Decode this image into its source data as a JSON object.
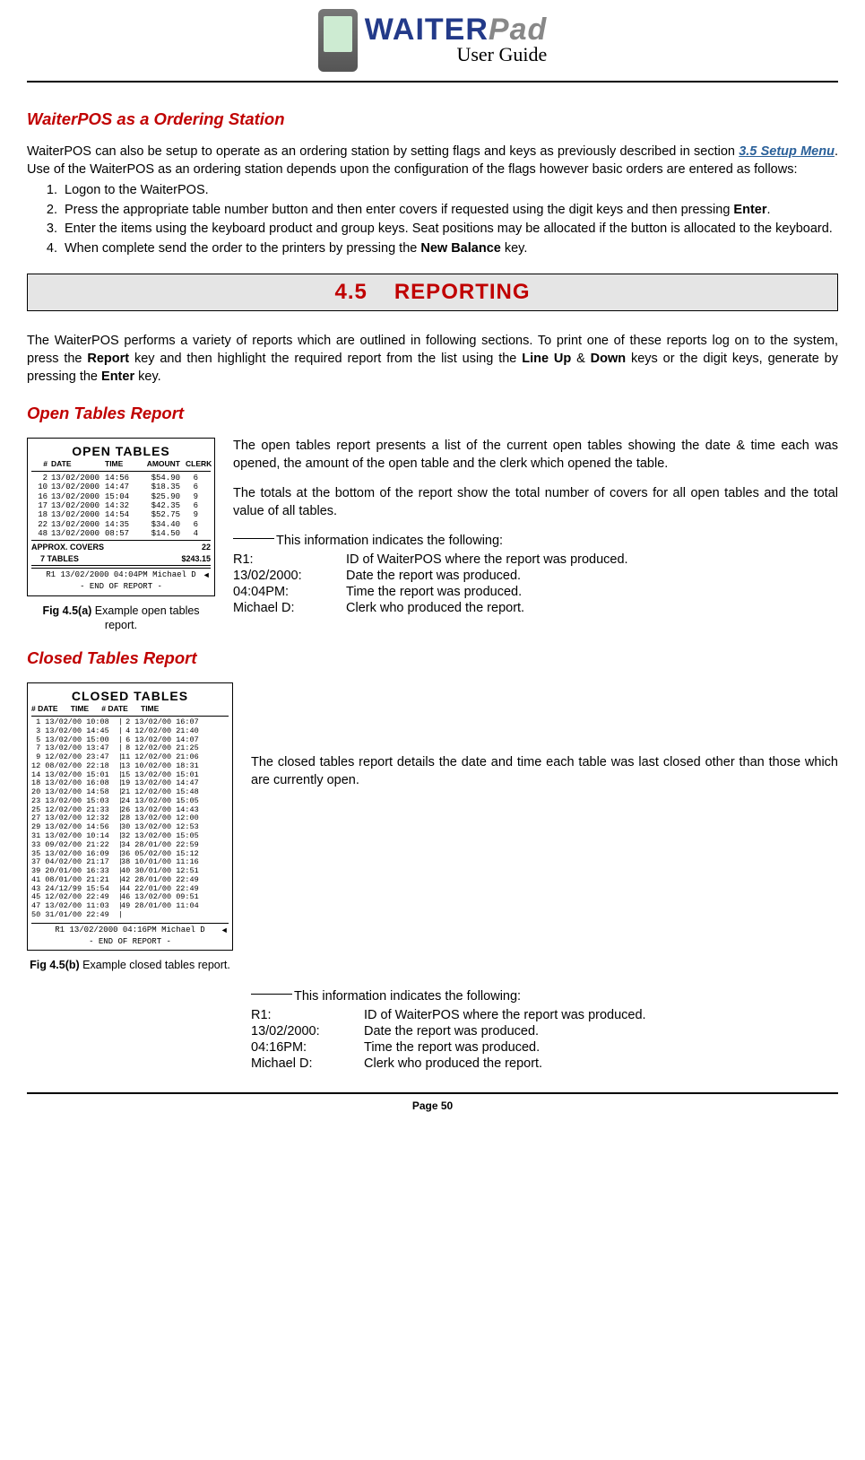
{
  "header": {
    "brand_main": "WAITER",
    "brand_sub": "Pad",
    "guide": "User Guide"
  },
  "s1": {
    "title": "WaiterPOS as a Ordering Station",
    "intro_a": "WaiterPOS can also be setup to operate as an ordering station by setting flags and keys as previously described in section ",
    "link": "3.5 Setup Menu",
    "intro_b": ". Use of the WaiterPOS as an ordering station depends upon the configuration of the flags however basic orders are entered as follows:",
    "steps": [
      "Logon to the WaiterPOS.",
      "Press the appropriate table number button and then enter covers if requested using the digit keys and then pressing <b>Enter</b>.",
      "Enter the items using the keyboard product and group keys. Seat positions may be allocated if the button is allocated to the keyboard.",
      "When complete send the order to the printers by pressing the <b>New Balance</b> key."
    ]
  },
  "chapter": {
    "num": "4.5",
    "title": "REPORTING"
  },
  "reporting_intro": "The WaiterPOS performs a variety of reports which are outlined in following sections. To print one of these reports log on to the system, press the <b>Report</b> key and then highlight the required report from the list using the <b>Line Up</b> & <b>Down</b> keys or the digit keys, generate by pressing the <b>Enter</b> key.",
  "open": {
    "title": "Open Tables Report",
    "fig_title": "OPEN  TABLES",
    "headers": [
      "#",
      "DATE",
      "TIME",
      "AMOUNT",
      "CLERK"
    ],
    "rows": [
      [
        "2",
        "13/02/2000",
        "14:56",
        "$54.90",
        "6"
      ],
      [
        "10",
        "13/02/2000",
        "14:47",
        "$18.35",
        "6"
      ],
      [
        "16",
        "13/02/2000",
        "15:04",
        "$25.90",
        "9"
      ],
      [
        "17",
        "13/02/2000",
        "14:32",
        "$42.35",
        "6"
      ],
      [
        "18",
        "13/02/2000",
        "14:54",
        "$52.75",
        "9"
      ],
      [
        "22",
        "13/02/2000",
        "14:35",
        "$34.40",
        "6"
      ],
      [
        "48",
        "13/02/2000",
        "08:57",
        "$14.50",
        "4"
      ]
    ],
    "totals": {
      "covers_label": "APPROX. COVERS",
      "covers": "22",
      "tables_label": "7 TABLES",
      "tables_amt": "$243.15"
    },
    "footline": "R1 13/02/2000 04:04PM Michael D",
    "endline": "- END OF REPORT -",
    "caption_label": "Fig 4.5(a)",
    "caption_text": " Example open tables report.",
    "para1": "The open tables report presents a list of the current open tables showing the date & time each was opened, the amount of the open table and the clerk which opened the table.",
    "para2": "The totals at the bottom of the report show the total number of covers for all open tables and the total value of all tables.",
    "info_lead": "This information indicates the following:",
    "info": [
      [
        "R1:",
        "ID of WaiterPOS where the report was produced."
      ],
      [
        "13/02/2000:",
        "Date the report was produced."
      ],
      [
        "04:04PM:",
        "Time the report was produced."
      ],
      [
        "Michael D:",
        "Clerk who produced the report."
      ]
    ]
  },
  "closed": {
    "title": "Closed Tables Report",
    "fig_title": "CLOSED  TABLES",
    "headers": "# DATE      TIME      # DATE      TIME",
    "rows": [
      [
        " 1 13/02/00 10:08  |",
        " 2 13/02/00 16:07"
      ],
      [
        " 3 13/02/00 14:45  |",
        " 4 12/02/00 21:40"
      ],
      [
        " 5 13/02/00 15:00  |",
        " 6 13/02/00 14:07"
      ],
      [
        " 7 13/02/00 13:47  |",
        " 8 12/02/00 21:25"
      ],
      [
        " 9 12/02/00 23:47  |",
        "11 12/02/00 21:06"
      ],
      [
        "12 08/02/00 22:18  |",
        "13 10/02/00 18:31"
      ],
      [
        "14 13/02/00 15:01  |",
        "15 13/02/00 15:01"
      ],
      [
        "18 13/02/00 16:08  |",
        "19 13/02/00 14:47"
      ],
      [
        "20 13/02/00 14:58  |",
        "21 12/02/00 15:48"
      ],
      [
        "23 13/02/00 15:03  |",
        "24 13/02/00 15:05"
      ],
      [
        "25 12/02/00 21:33  |",
        "26 13/02/00 14:43"
      ],
      [
        "27 13/02/00 12:32  |",
        "28 13/02/00 12:00"
      ],
      [
        "29 13/02/00 14:56  |",
        "30 13/02/00 12:53"
      ],
      [
        "31 13/02/00 10:14  |",
        "32 13/02/00 15:05"
      ],
      [
        "33 09/02/00 21:22  |",
        "34 28/01/00 22:59"
      ],
      [
        "35 13/02/00 16:09  |",
        "36 05/02/00 15:12"
      ],
      [
        "37 04/02/00 21:17  |",
        "38 10/01/00 11:16"
      ],
      [
        "39 20/01/00 16:33  |",
        "40 30/01/00 12:51"
      ],
      [
        "41 08/01/00 21:21  |",
        "42 28/01/00 22:49"
      ],
      [
        "43 24/12/99 15:54  |",
        "44 22/01/00 22:49"
      ],
      [
        "45 12/02/00 22:49  |",
        "46 13/02/00 09:51"
      ],
      [
        "47 13/02/00 11:03  |",
        "49 28/01/00 11:04"
      ],
      [
        "50 31/01/00 22:49  |",
        ""
      ]
    ],
    "footline": "R1 13/02/2000 04:16PM Michael D",
    "endline": "- END OF REPORT -",
    "caption_label": "Fig 4.5(b)",
    "caption_text": " Example closed tables report.",
    "para1": "The closed tables report details the date and time each table was last closed other than those which are currently open.",
    "info_lead": "This information indicates the following:",
    "info": [
      [
        "R1:",
        "ID of WaiterPOS where the report was produced."
      ],
      [
        "13/02/2000:",
        "Date the report was produced."
      ],
      [
        "04:16PM:",
        "Time the report was produced."
      ],
      [
        "Michael D:",
        "Clerk who produced the report."
      ]
    ]
  },
  "footer": "Page 50"
}
